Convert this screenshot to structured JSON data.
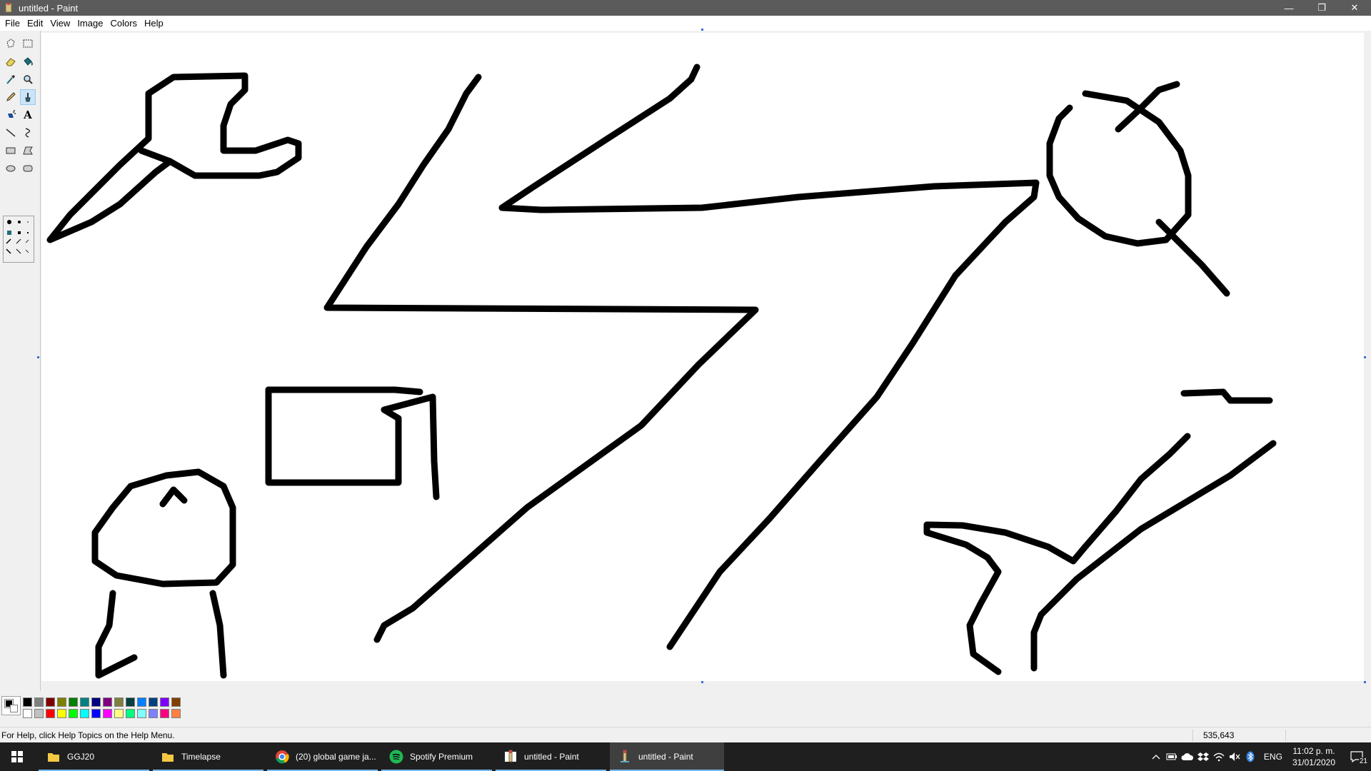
{
  "window": {
    "title": "untitled - Paint",
    "minimize_glyph": "—",
    "restore_glyph": "❐",
    "close_glyph": "✕"
  },
  "menu": [
    "File",
    "Edit",
    "View",
    "Image",
    "Colors",
    "Help"
  ],
  "tools": [
    {
      "name": "free-form-select",
      "icon": "free-form-select-icon"
    },
    {
      "name": "select",
      "icon": "select-icon"
    },
    {
      "name": "eraser",
      "icon": "eraser-icon"
    },
    {
      "name": "fill-with-color",
      "icon": "fill-bucket-icon"
    },
    {
      "name": "pick-color",
      "icon": "eyedropper-icon"
    },
    {
      "name": "magnifier",
      "icon": "magnifier-icon"
    },
    {
      "name": "pencil",
      "icon": "pencil-icon"
    },
    {
      "name": "brush",
      "icon": "brush-icon",
      "active": true
    },
    {
      "name": "airbrush",
      "icon": "airbrush-icon"
    },
    {
      "name": "text",
      "icon": "text-icon",
      "glyph": "A"
    },
    {
      "name": "line",
      "icon": "line-icon"
    },
    {
      "name": "curve",
      "icon": "curve-icon"
    },
    {
      "name": "rectangle",
      "icon": "rectangle-icon"
    },
    {
      "name": "polygon",
      "icon": "polygon-icon"
    },
    {
      "name": "ellipse",
      "icon": "ellipse-icon"
    },
    {
      "name": "rounded-rectangle",
      "icon": "rounded-rectangle-icon"
    }
  ],
  "palette": {
    "foreground": "#000000",
    "background": "#ffffff",
    "row1": [
      "#000000",
      "#808080",
      "#800000",
      "#808000",
      "#008000",
      "#008080",
      "#000080",
      "#800080",
      "#808040",
      "#004040",
      "#0080ff",
      "#004080",
      "#8000ff",
      "#804000"
    ],
    "row2": [
      "#ffffff",
      "#c0c0c0",
      "#ff0000",
      "#ffff00",
      "#00ff00",
      "#00ffff",
      "#0000ff",
      "#ff00ff",
      "#ffff80",
      "#00ff80",
      "#80ffff",
      "#8080ff",
      "#ff0080",
      "#ff8040"
    ]
  },
  "status": {
    "help": "For Help, click Help Topics on the Help Menu.",
    "coords": "535,643"
  },
  "taskbar": {
    "items": [
      {
        "label": "GGJ20",
        "icon": "folder-icon",
        "active": false
      },
      {
        "label": "Timelapse",
        "icon": "folder-icon",
        "active": false
      },
      {
        "label": "(20) global game ja...",
        "icon": "chrome-icon",
        "active": false
      },
      {
        "label": "Spotify Premium",
        "icon": "spotify-icon",
        "active": false
      },
      {
        "label": "untitled - Paint",
        "icon": "paint-icon",
        "active": false
      },
      {
        "label": "untitled - Paint",
        "icon": "paint-icon",
        "active": true
      }
    ],
    "tray": {
      "language": "ENG",
      "time": "11:02 p. m.",
      "date": "31/01/2020",
      "notifications": "21"
    }
  }
}
